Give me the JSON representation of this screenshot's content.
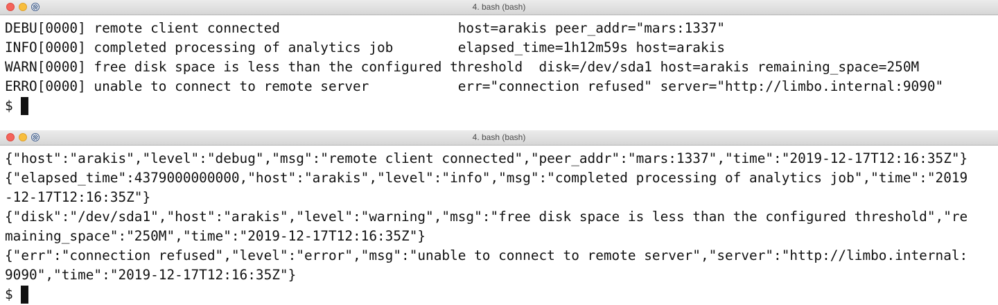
{
  "term1": {
    "title": "4. bash (bash)",
    "lines": [
      "DEBU[0000] remote client connected                      host=arakis peer_addr=\"mars:1337\"",
      "INFO[0000] completed processing of analytics job        elapsed_time=1h12m59s host=arakis",
      "WARN[0000] free disk space is less than the configured threshold  disk=/dev/sda1 host=arakis remaining_space=250M",
      "ERRO[0000] unable to connect to remote server           err=\"connection refused\" server=\"http://limbo.internal:9090\""
    ],
    "prompt": "$ "
  },
  "term2": {
    "title": "4. bash (bash)",
    "lines": [
      "{\"host\":\"arakis\",\"level\":\"debug\",\"msg\":\"remote client connected\",\"peer_addr\":\"mars:1337\",\"time\":\"2019-12-17T12:16:35Z\"}",
      "{\"elapsed_time\":4379000000000,\"host\":\"arakis\",\"level\":\"info\",\"msg\":\"completed processing of analytics job\",\"time\":\"2019",
      "-12-17T12:16:35Z\"}",
      "{\"disk\":\"/dev/sda1\",\"host\":\"arakis\",\"level\":\"warning\",\"msg\":\"free disk space is less than the configured threshold\",\"re",
      "maining_space\":\"250M\",\"time\":\"2019-12-17T12:16:35Z\"}",
      "{\"err\":\"connection refused\",\"level\":\"error\",\"msg\":\"unable to connect to remote server\",\"server\":\"http://limbo.internal:",
      "9090\",\"time\":\"2019-12-17T12:16:35Z\"}"
    ],
    "prompt": "$ "
  }
}
